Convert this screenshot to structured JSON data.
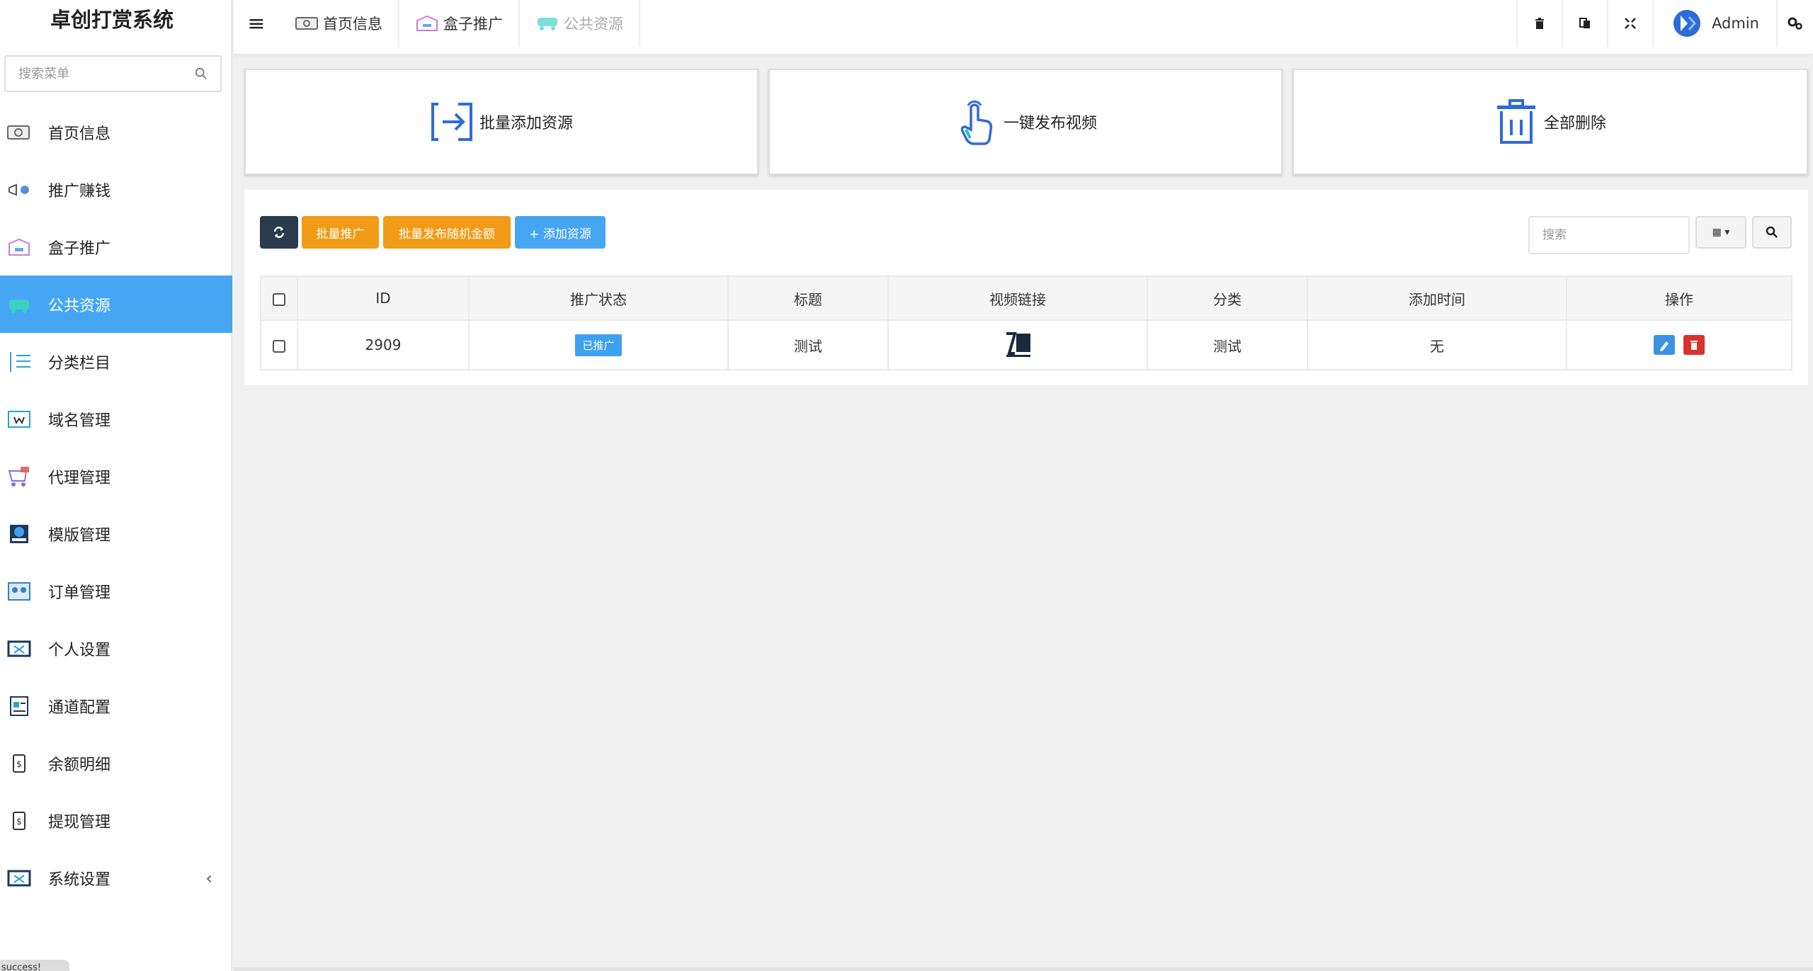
{
  "app": {
    "title": "卓创打赏系统"
  },
  "sidebar": {
    "search_placeholder": "搜索菜单",
    "items": [
      {
        "label": "首页信息",
        "icon": "money-icon"
      },
      {
        "label": "推广赚钱",
        "icon": "promo-icon"
      },
      {
        "label": "盒子推广",
        "icon": "box-icon"
      },
      {
        "label": "公共资源",
        "icon": "public-resource-icon",
        "active": true
      },
      {
        "label": "分类栏目",
        "icon": "category-icon"
      },
      {
        "label": "域名管理",
        "icon": "domain-icon"
      },
      {
        "label": "代理管理",
        "icon": "agent-icon"
      },
      {
        "label": "模版管理",
        "icon": "template-icon"
      },
      {
        "label": "订单管理",
        "icon": "order-icon"
      },
      {
        "label": "个人设置",
        "icon": "personal-settings-icon"
      },
      {
        "label": "通道配置",
        "icon": "channel-icon"
      },
      {
        "label": "余额明细",
        "icon": "balance-icon"
      },
      {
        "label": "提现管理",
        "icon": "withdraw-icon"
      },
      {
        "label": "系统设置",
        "icon": "system-settings-icon",
        "has_submenu": true
      }
    ],
    "bottom_tip": "success!"
  },
  "topbar": {
    "tabs": [
      {
        "label": "首页信息"
      },
      {
        "label": "盒子推广"
      },
      {
        "label": "公共资源"
      }
    ],
    "user": "Admin"
  },
  "cards": [
    {
      "label": "批量添加资源",
      "icon": "import-icon"
    },
    {
      "label": "一键发布视频",
      "icon": "tap-icon"
    },
    {
      "label": "全部删除",
      "icon": "trash-icon"
    }
  ],
  "toolbar": {
    "batch_promote": "批量推广",
    "batch_random": "批量发布随机金额",
    "add_resource": "+ 添加资源",
    "search_placeholder": "搜索"
  },
  "table": {
    "headers": [
      "ID",
      "推广状态",
      "标题",
      "视频链接",
      "分类",
      "添加时间",
      "操作"
    ],
    "rows": [
      {
        "id": "2909",
        "status": "已推广",
        "title": "测试",
        "category": "测试",
        "time": "无"
      }
    ]
  },
  "colors": {
    "accent": "#46a6f3",
    "orange": "#f19b16",
    "dark": "#2a3b4d",
    "danger": "#d8322e"
  }
}
